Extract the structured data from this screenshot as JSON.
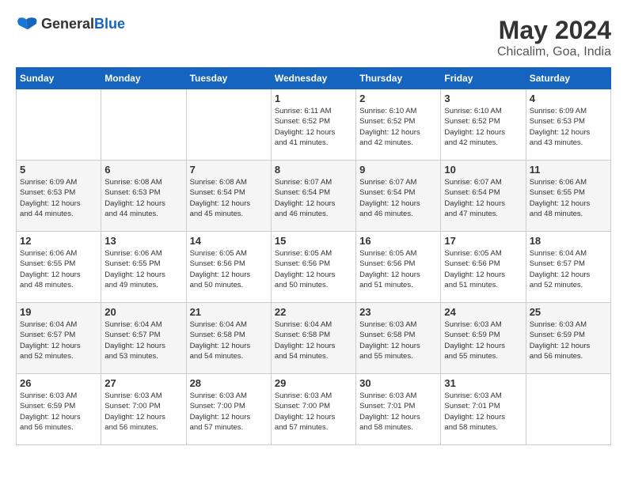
{
  "header": {
    "logo_general": "General",
    "logo_blue": "Blue",
    "month_year": "May 2024",
    "location": "Chicalim, Goa, India"
  },
  "weekdays": [
    "Sunday",
    "Monday",
    "Tuesday",
    "Wednesday",
    "Thursday",
    "Friday",
    "Saturday"
  ],
  "weeks": [
    [
      {
        "day": "",
        "sunrise": "",
        "sunset": "",
        "daylight": ""
      },
      {
        "day": "",
        "sunrise": "",
        "sunset": "",
        "daylight": ""
      },
      {
        "day": "",
        "sunrise": "",
        "sunset": "",
        "daylight": ""
      },
      {
        "day": "1",
        "sunrise": "Sunrise: 6:11 AM",
        "sunset": "Sunset: 6:52 PM",
        "daylight": "Daylight: 12 hours and 41 minutes."
      },
      {
        "day": "2",
        "sunrise": "Sunrise: 6:10 AM",
        "sunset": "Sunset: 6:52 PM",
        "daylight": "Daylight: 12 hours and 42 minutes."
      },
      {
        "day": "3",
        "sunrise": "Sunrise: 6:10 AM",
        "sunset": "Sunset: 6:52 PM",
        "daylight": "Daylight: 12 hours and 42 minutes."
      },
      {
        "day": "4",
        "sunrise": "Sunrise: 6:09 AM",
        "sunset": "Sunset: 6:53 PM",
        "daylight": "Daylight: 12 hours and 43 minutes."
      }
    ],
    [
      {
        "day": "5",
        "sunrise": "Sunrise: 6:09 AM",
        "sunset": "Sunset: 6:53 PM",
        "daylight": "Daylight: 12 hours and 44 minutes."
      },
      {
        "day": "6",
        "sunrise": "Sunrise: 6:08 AM",
        "sunset": "Sunset: 6:53 PM",
        "daylight": "Daylight: 12 hours and 44 minutes."
      },
      {
        "day": "7",
        "sunrise": "Sunrise: 6:08 AM",
        "sunset": "Sunset: 6:54 PM",
        "daylight": "Daylight: 12 hours and 45 minutes."
      },
      {
        "day": "8",
        "sunrise": "Sunrise: 6:07 AM",
        "sunset": "Sunset: 6:54 PM",
        "daylight": "Daylight: 12 hours and 46 minutes."
      },
      {
        "day": "9",
        "sunrise": "Sunrise: 6:07 AM",
        "sunset": "Sunset: 6:54 PM",
        "daylight": "Daylight: 12 hours and 46 minutes."
      },
      {
        "day": "10",
        "sunrise": "Sunrise: 6:07 AM",
        "sunset": "Sunset: 6:54 PM",
        "daylight": "Daylight: 12 hours and 47 minutes."
      },
      {
        "day": "11",
        "sunrise": "Sunrise: 6:06 AM",
        "sunset": "Sunset: 6:55 PM",
        "daylight": "Daylight: 12 hours and 48 minutes."
      }
    ],
    [
      {
        "day": "12",
        "sunrise": "Sunrise: 6:06 AM",
        "sunset": "Sunset: 6:55 PM",
        "daylight": "Daylight: 12 hours and 48 minutes."
      },
      {
        "day": "13",
        "sunrise": "Sunrise: 6:06 AM",
        "sunset": "Sunset: 6:55 PM",
        "daylight": "Daylight: 12 hours and 49 minutes."
      },
      {
        "day": "14",
        "sunrise": "Sunrise: 6:05 AM",
        "sunset": "Sunset: 6:56 PM",
        "daylight": "Daylight: 12 hours and 50 minutes."
      },
      {
        "day": "15",
        "sunrise": "Sunrise: 6:05 AM",
        "sunset": "Sunset: 6:56 PM",
        "daylight": "Daylight: 12 hours and 50 minutes."
      },
      {
        "day": "16",
        "sunrise": "Sunrise: 6:05 AM",
        "sunset": "Sunset: 6:56 PM",
        "daylight": "Daylight: 12 hours and 51 minutes."
      },
      {
        "day": "17",
        "sunrise": "Sunrise: 6:05 AM",
        "sunset": "Sunset: 6:56 PM",
        "daylight": "Daylight: 12 hours and 51 minutes."
      },
      {
        "day": "18",
        "sunrise": "Sunrise: 6:04 AM",
        "sunset": "Sunset: 6:57 PM",
        "daylight": "Daylight: 12 hours and 52 minutes."
      }
    ],
    [
      {
        "day": "19",
        "sunrise": "Sunrise: 6:04 AM",
        "sunset": "Sunset: 6:57 PM",
        "daylight": "Daylight: 12 hours and 52 minutes."
      },
      {
        "day": "20",
        "sunrise": "Sunrise: 6:04 AM",
        "sunset": "Sunset: 6:57 PM",
        "daylight": "Daylight: 12 hours and 53 minutes."
      },
      {
        "day": "21",
        "sunrise": "Sunrise: 6:04 AM",
        "sunset": "Sunset: 6:58 PM",
        "daylight": "Daylight: 12 hours and 54 minutes."
      },
      {
        "day": "22",
        "sunrise": "Sunrise: 6:04 AM",
        "sunset": "Sunset: 6:58 PM",
        "daylight": "Daylight: 12 hours and 54 minutes."
      },
      {
        "day": "23",
        "sunrise": "Sunrise: 6:03 AM",
        "sunset": "Sunset: 6:58 PM",
        "daylight": "Daylight: 12 hours and 55 minutes."
      },
      {
        "day": "24",
        "sunrise": "Sunrise: 6:03 AM",
        "sunset": "Sunset: 6:59 PM",
        "daylight": "Daylight: 12 hours and 55 minutes."
      },
      {
        "day": "25",
        "sunrise": "Sunrise: 6:03 AM",
        "sunset": "Sunset: 6:59 PM",
        "daylight": "Daylight: 12 hours and 56 minutes."
      }
    ],
    [
      {
        "day": "26",
        "sunrise": "Sunrise: 6:03 AM",
        "sunset": "Sunset: 6:59 PM",
        "daylight": "Daylight: 12 hours and 56 minutes."
      },
      {
        "day": "27",
        "sunrise": "Sunrise: 6:03 AM",
        "sunset": "Sunset: 7:00 PM",
        "daylight": "Daylight: 12 hours and 56 minutes."
      },
      {
        "day": "28",
        "sunrise": "Sunrise: 6:03 AM",
        "sunset": "Sunset: 7:00 PM",
        "daylight": "Daylight: 12 hours and 57 minutes."
      },
      {
        "day": "29",
        "sunrise": "Sunrise: 6:03 AM",
        "sunset": "Sunset: 7:00 PM",
        "daylight": "Daylight: 12 hours and 57 minutes."
      },
      {
        "day": "30",
        "sunrise": "Sunrise: 6:03 AM",
        "sunset": "Sunset: 7:01 PM",
        "daylight": "Daylight: 12 hours and 58 minutes."
      },
      {
        "day": "31",
        "sunrise": "Sunrise: 6:03 AM",
        "sunset": "Sunset: 7:01 PM",
        "daylight": "Daylight: 12 hours and 58 minutes."
      },
      {
        "day": "",
        "sunrise": "",
        "sunset": "",
        "daylight": ""
      }
    ]
  ]
}
